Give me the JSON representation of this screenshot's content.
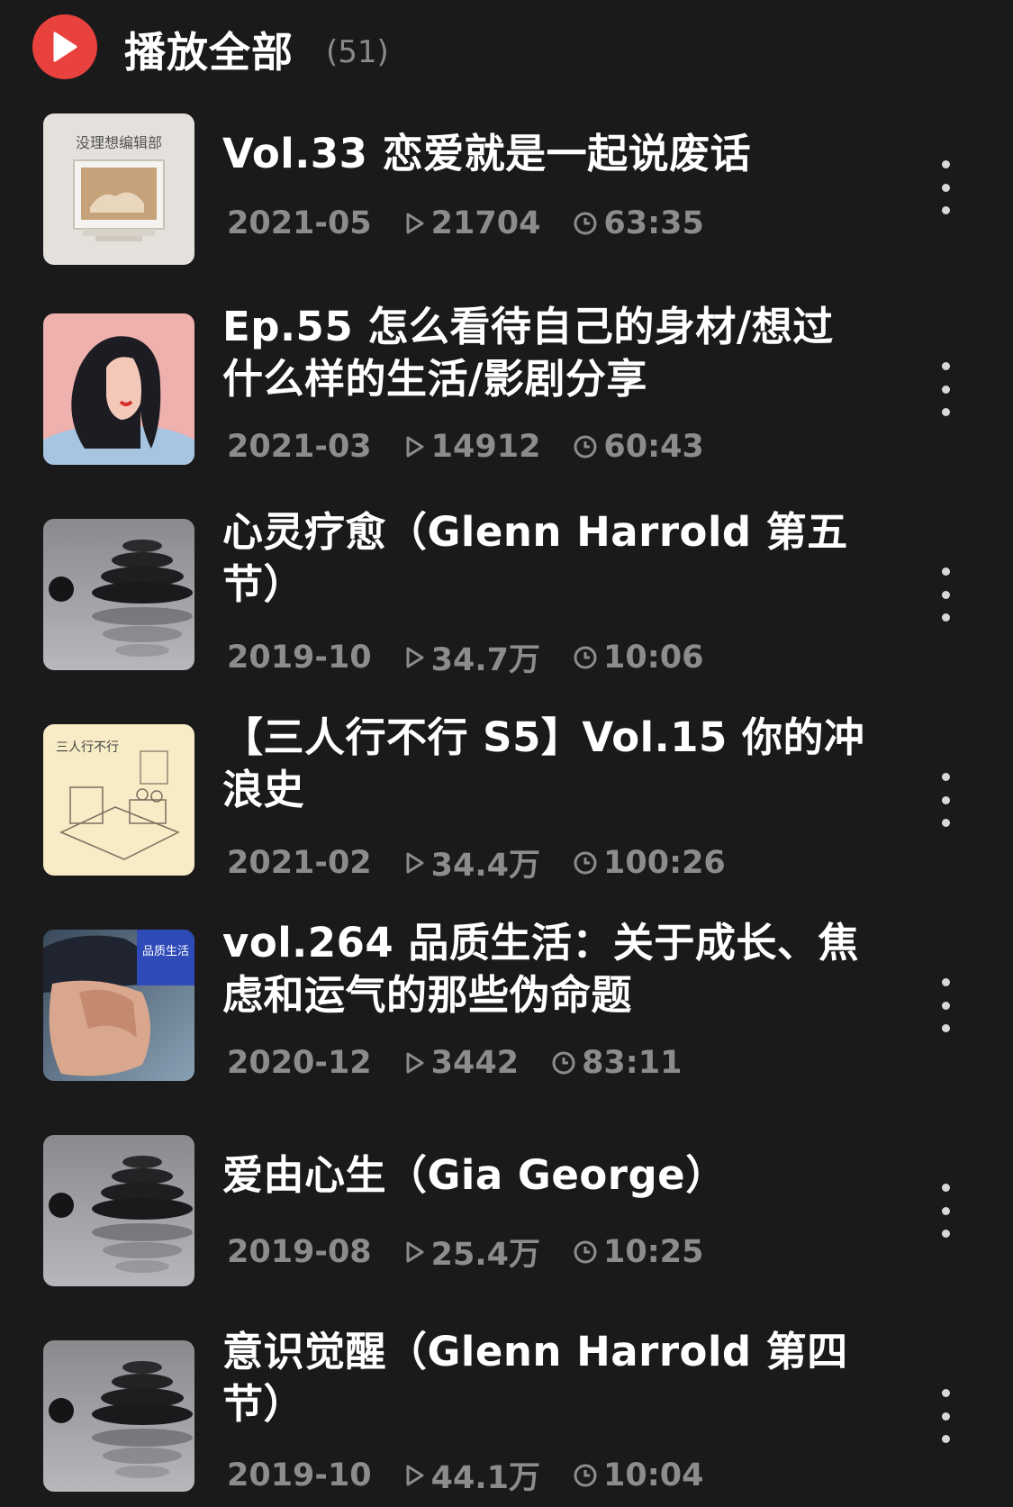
{
  "header": {
    "title": "播放全部",
    "count": "(51)",
    "accent_color": "#e9413d",
    "icon": "play-icon"
  },
  "items": [
    {
      "title": "Vol.33 恋爱就是一起说废话",
      "date": "2021-05",
      "plays": "21704",
      "duration": "63:35",
      "cover_text": "没理想编辑部",
      "cover_icon": "retro-computer-cover"
    },
    {
      "title": "Ep.55 怎么看待自己的身材/想过什么样的生活/影剧分享",
      "date": "2021-03",
      "plays": "14912",
      "duration": "60:43",
      "cover_icon": "woman-illustration-cover"
    },
    {
      "title": "心灵疗愈（Glenn Harrold 第五节）",
      "date": "2019-10",
      "plays": "34.7万",
      "duration": "10:06",
      "cover_icon": "stacked-stones-cover"
    },
    {
      "title": "【三人行不行 S5】Vol.15 你的冲浪史",
      "date": "2021-02",
      "plays": "34.4万",
      "duration": "100:26",
      "cover_text": "三人行不行",
      "cover_icon": "sketch-room-cover"
    },
    {
      "title": "vol.264 品质生活：关于成长、焦虑和运气的那些伪命题",
      "date": "2020-12",
      "plays": "3442",
      "duration": "83:11",
      "cover_text": "品质生活",
      "cover_icon": "man-face-cover"
    },
    {
      "title": "爱由心生（Gia George）",
      "date": "2019-08",
      "plays": "25.4万",
      "duration": "10:25",
      "cover_icon": "stacked-stones-cover"
    },
    {
      "title": "意识觉醒（Glenn Harrold 第四节）",
      "date": "2019-10",
      "plays": "44.1万",
      "duration": "10:04",
      "cover_icon": "stacked-stones-cover"
    }
  ]
}
